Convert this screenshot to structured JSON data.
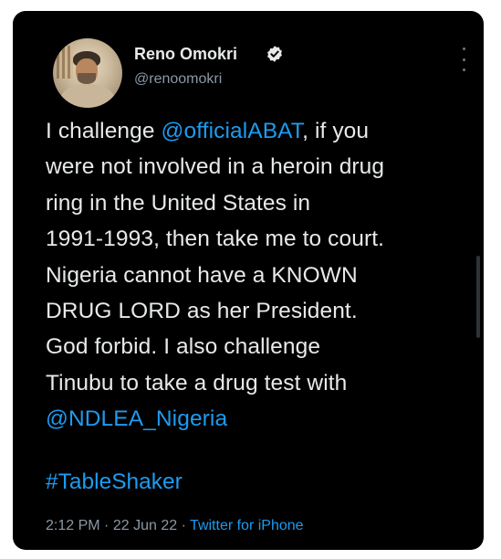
{
  "tweet": {
    "author": {
      "display_name": "Reno Omokri",
      "handle": "@renoomokri",
      "verified": true
    },
    "body_lines": [
      [
        {
          "text": "I challenge "
        },
        {
          "text": "@officialABAT",
          "mention": true
        },
        {
          "text": ", if you"
        }
      ],
      [
        {
          "text": "were not involved in a heroin drug"
        }
      ],
      [
        {
          "text": "ring in the United States in"
        }
      ],
      [
        {
          "text": "1991-1993, then take me to court."
        }
      ],
      [
        {
          "text": "Nigeria cannot have a KNOWN"
        }
      ],
      [
        {
          "text": "DRUG LORD as her President."
        }
      ],
      [
        {
          "text": "God forbid. I also challenge"
        }
      ],
      [
        {
          "text": "Tinubu to take a drug test with"
        }
      ],
      [
        {
          "text": "@NDLEA_Nigeria",
          "mention": true
        }
      ]
    ],
    "hashtag": "#TableShaker",
    "time": "2:12 PM",
    "separator": "·",
    "date": "22 Jun 22",
    "source": "Twitter for iPhone"
  },
  "icons": {
    "verified": "verified-badge-icon",
    "more": "more-vertical-icon"
  },
  "colors": {
    "background": "#000000",
    "text": "#e7e9ea",
    "secondary_text": "#8b98a5",
    "link": "#1d9bf0"
  }
}
